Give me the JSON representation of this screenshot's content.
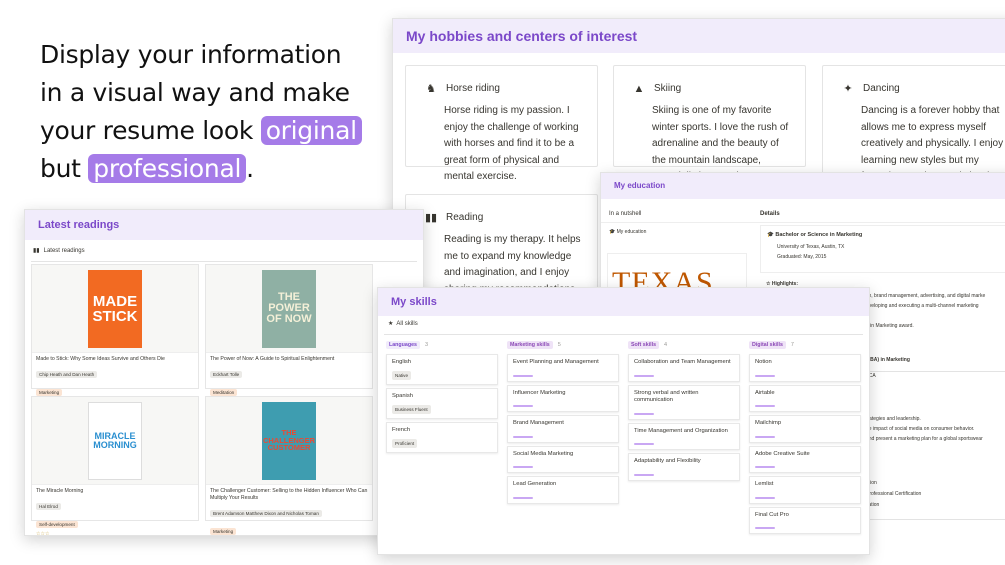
{
  "tagline": {
    "l1": "Display your information",
    "l2": "in a visual way and make",
    "l3_pre": "your resume look ",
    "l3_hl": "original",
    "l4_pre": "but ",
    "l4_hl": "professional",
    "l4_post": "."
  },
  "hobbies": {
    "title": "My hobbies and centers of interest",
    "items": [
      {
        "name": "Horse riding",
        "icon": "horse-icon",
        "text": "Horse riding is my passion. I enjoy the challenge of working with horses and find it to be a great form of physical and mental exercise."
      },
      {
        "name": "Skiing",
        "icon": "mountain-icon",
        "text": "Skiing is one of my favorite winter sports. I love the rush of adrenaline and the beauty of the mountain landscape, especially in Canada."
      },
      {
        "name": "Dancing",
        "icon": "dancer-icon",
        "text": "Dancing is a forever hobby that allows me to express myself creatively and physically. I enjoy learning new styles but my favourites are jazz and classic."
      },
      {
        "name": "Reading",
        "icon": "book-icon",
        "text": "Reading is my therapy. It helps me to expand my knowledge and imagination, and I enjoy sharing my recommendations with others."
      }
    ]
  },
  "readings": {
    "title": "Latest readings",
    "tab": "Latest readings",
    "books": [
      {
        "title": "Made to Stick: Why Some Ideas Survive and Others Die",
        "author": "Chip Heath and Dan Heath",
        "tag": "Marketing",
        "stars": "☆☆☆",
        "cover": "MADE STICK"
      },
      {
        "title": "The Power of Now: A Guide to Spiritual Enlightenment",
        "author": "Eckhart Tolle",
        "tag": "Meditation",
        "stars": "☆☆☆",
        "cover": "THE POWER OF NOW"
      },
      {
        "title": "The Miracle Morning",
        "author": "Hal Elrod",
        "tag": "Self-development",
        "stars": "☆☆☆",
        "cover": "MIRACLE MORNING"
      },
      {
        "title": "The Challenger Customer: Selling to the Hidden Influencer Who Can Multiply Your Results",
        "author": "Brent Adamson Matthew Dixon and Nicholas Toman",
        "tag": "Marketing",
        "stars": "☆☆☆",
        "cover": "THE CHALLENGER CUSTOMER"
      }
    ]
  },
  "education": {
    "title": "My education",
    "nutshell": "In a nutshell",
    "details": "Details",
    "my_edu": "My education",
    "logo": "TEXAS",
    "degree": "Bachelor or Science in Marketing",
    "uni": "University of Texas, Austin, TX",
    "grad": "Graduated: May, 2015",
    "highlights": "Highlights:",
    "frag": [
      "ch, brand management, advertising, and digital marke",
      "eveloping and executing a multi-channel marketing",
      "s.",
      "e in Marketing award.",
      "MBA) in Marketing",
      ", CA",
      "trategies and leadership.",
      "he impact of social media on consumer behavior.",
      "and present a marketing plan for a global sportswear",
      "ation",
      "Professional Certification",
      "cation"
    ]
  },
  "skills": {
    "title": "My skills",
    "tab": "All skills",
    "columns": [
      {
        "name": "Languages",
        "count": "3",
        "color": "#f1ecfb",
        "text": "#7b48c9",
        "items": [
          {
            "n": "English",
            "p": "Native"
          },
          {
            "n": "Spanish",
            "p": "Business Fluent"
          },
          {
            "n": "French",
            "p": "Proficient"
          }
        ]
      },
      {
        "name": "Marketing skills",
        "count": "5",
        "color": "#efe3f7",
        "text": "#8b48b6",
        "items": [
          {
            "n": "Event Planning and Management"
          },
          {
            "n": "Influencer Marketing"
          },
          {
            "n": "Brand Management"
          },
          {
            "n": "Social Media Marketing"
          },
          {
            "n": "Lead Generation"
          }
        ]
      },
      {
        "name": "Soft skills",
        "count": "4",
        "color": "#efe3f7",
        "text": "#8b48b6",
        "items": [
          {
            "n": "Collaboration and Team Management"
          },
          {
            "n": "Strong verbal and written communication"
          },
          {
            "n": "Time Management and Organization"
          },
          {
            "n": "Adaptability and Flexibility"
          }
        ]
      },
      {
        "name": "Digital skills",
        "count": "7",
        "color": "#efe3f7",
        "text": "#8b48b6",
        "items": [
          {
            "n": "Notion"
          },
          {
            "n": "Airtable"
          },
          {
            "n": "Mailchimp"
          },
          {
            "n": "Adobe Creative Suite"
          },
          {
            "n": "Lemlist"
          },
          {
            "n": "Final Cut Pro"
          }
        ]
      }
    ]
  }
}
